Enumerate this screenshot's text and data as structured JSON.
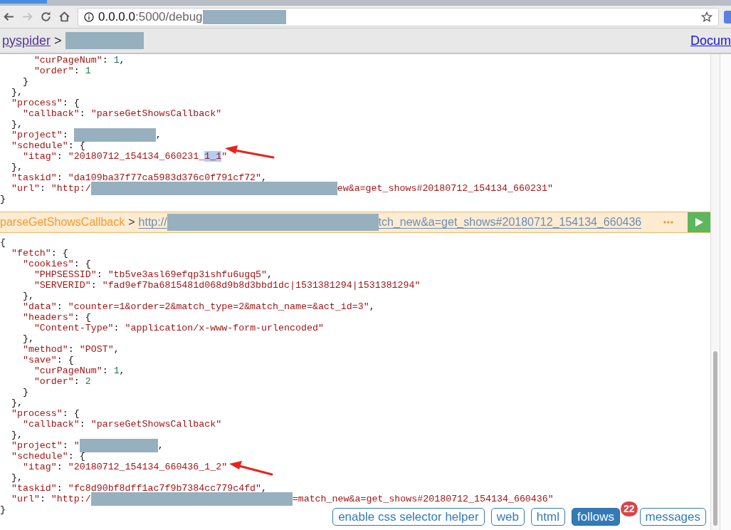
{
  "browser": {
    "nav_buttons": [
      {
        "kind": "back",
        "disabled": false
      },
      {
        "kind": "forward",
        "disabled": true
      },
      {
        "kind": "reload",
        "disabled": false
      },
      {
        "kind": "home",
        "disabled": false
      }
    ],
    "url_parts": [
      {
        "kind": "strong",
        "text": "0.0.0.0"
      },
      {
        "kind": "plain",
        "text": ":5000/debug"
      },
      {
        "kind": "redacted"
      }
    ]
  },
  "header": {
    "breadcrumb_link": "pyspider",
    "separator": ">",
    "name_redacted": true,
    "docs_link": "Docum"
  },
  "previous_task": {
    "lines": [
      {
        "text": "      \"curPageNum\": 1,"
      },
      {
        "text": "      \"order\": 1"
      },
      {
        "text": "    }"
      },
      {
        "text": "  },"
      },
      {
        "text": "  \"process\": {"
      },
      {
        "text": "    \"callback\": \"parseGetShowsCallback\""
      },
      {
        "text": "  },"
      },
      {
        "parts": [
          {
            "kind": "code",
            "text": "  \"project\": "
          },
          {
            "kind": "redacted"
          },
          {
            "kind": "code",
            "text": ","
          }
        ]
      },
      {
        "text": "  \"schedule\": {"
      },
      {
        "parts": [
          {
            "kind": "code",
            "text": "    \"itag\": \"20180712_154134_660231_"
          },
          {
            "kind": "highlight",
            "text": "1_1"
          },
          {
            "kind": "code",
            "text": "\""
          }
        ]
      },
      {
        "text": "  },"
      },
      {
        "text": "  \"taskid\": \"da109ba37f77ca5983d376c0f791cf72\","
      },
      {
        "parts": [
          {
            "kind": "code",
            "text": "  \"url\": \"http:/"
          },
          {
            "kind": "redacted"
          },
          {
            "kind": "str",
            "text": "ew&a=get_shows#20180712_154134_660231\""
          }
        ]
      },
      {
        "text": "}"
      }
    ]
  },
  "task_bar": {
    "callback": "parseGetShowsCallback",
    "separator": ">",
    "url_parts": [
      {
        "kind": "plain",
        "text": "http://"
      },
      {
        "kind": "redacted"
      },
      {
        "kind": "plain",
        "text": "tch_new&a=get_shows#20180712_154134_660436"
      }
    ]
  },
  "task": {
    "lines": [
      {
        "text": "{"
      },
      {
        "text": "  \"fetch\": {"
      },
      {
        "text": "    \"cookies\": {"
      },
      {
        "text": "      \"PHPSESSID\": \"tb5ve3asl69efqp3ishfu6ugq5\","
      },
      {
        "text": "      \"SERVERID\": \"fad9ef7ba6815481d068d9b8d3bbd1dc|1531381294|1531381294\""
      },
      {
        "text": "    },"
      },
      {
        "text": "    \"data\": \"counter=1&order=2&match_type=2&match_name=&act_id=3\","
      },
      {
        "text": "    \"headers\": {"
      },
      {
        "text": "      \"Content-Type\": \"application/x-www-form-urlencoded\""
      },
      {
        "text": "    },"
      },
      {
        "text": "    \"method\": \"POST\","
      },
      {
        "text": "    \"save\": {"
      },
      {
        "text": "      \"curPageNum\": 1,"
      },
      {
        "text": "      \"order\": 2"
      },
      {
        "text": "    }"
      },
      {
        "text": "  },"
      },
      {
        "text": "  \"process\": {"
      },
      {
        "text": "    \"callback\": \"parseGetShowsCallback\""
      },
      {
        "text": "  },"
      },
      {
        "parts": [
          {
            "kind": "code",
            "text": "  \"project\": \""
          },
          {
            "kind": "redacted"
          },
          {
            "kind": "code",
            "text": ","
          }
        ]
      },
      {
        "text": "  \"schedule\": {"
      },
      {
        "text": "    \"itag\": \"20180712_154134_660436_1_2\""
      },
      {
        "text": "  },"
      },
      {
        "text": "  \"taskid\": \"fc8d90bf8dff1ac7f9b7384cc779c4fd\","
      },
      {
        "parts": [
          {
            "kind": "code",
            "text": "  \"url\": \"http:/"
          },
          {
            "kind": "redacted"
          },
          {
            "kind": "str",
            "text": "=match_new&a=get_shows#20180712_154134_660436\""
          }
        ]
      },
      {
        "text": "}"
      }
    ]
  },
  "buttons": [
    {
      "label": "enable css selector helper",
      "selected": false
    },
    {
      "label": "web",
      "selected": false
    },
    {
      "label": "html",
      "selected": false
    },
    {
      "label": "follows",
      "selected": true,
      "badge": "22"
    },
    {
      "label": "messages",
      "selected": false
    }
  ]
}
